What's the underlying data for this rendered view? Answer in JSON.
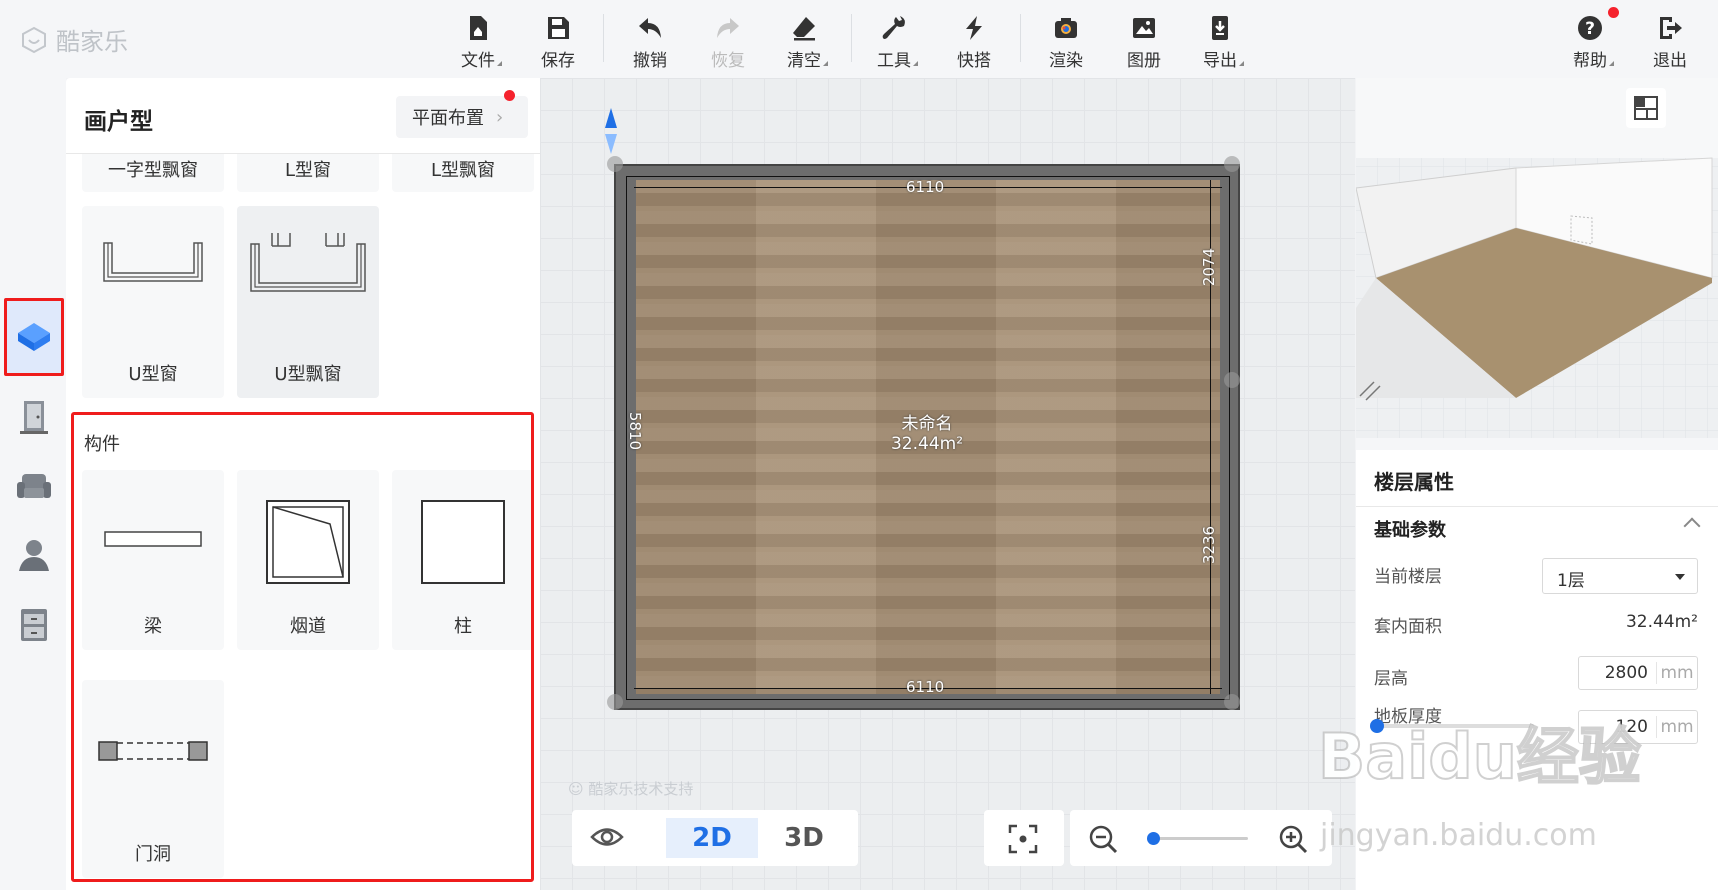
{
  "app": {
    "logo": "酷家乐"
  },
  "toolbar": [
    {
      "label": "文件",
      "icon": "file-icon"
    },
    {
      "label": "保存",
      "icon": "save-icon"
    },
    {
      "label": "撤销",
      "icon": "undo-icon"
    },
    {
      "label": "恢复",
      "icon": "redo-icon"
    },
    {
      "label": "清空",
      "icon": "eraser-icon"
    },
    {
      "label": "工具",
      "icon": "wrench-icon"
    },
    {
      "label": "快搭",
      "icon": "lightning-icon"
    },
    {
      "label": "渲染",
      "icon": "camera-icon"
    },
    {
      "label": "图册",
      "icon": "image-icon"
    },
    {
      "label": "导出",
      "icon": "export-icon"
    },
    {
      "label": "帮助",
      "icon": "help-icon"
    },
    {
      "label": "退出",
      "icon": "logout-icon"
    }
  ],
  "panel": {
    "title": "画户型",
    "layout_button": "平面布置",
    "partial_row": [
      "一字型飘窗",
      "L型窗",
      "L型飘窗"
    ],
    "windows": [
      "U型窗",
      "U型飘窗"
    ],
    "section_label": "构件",
    "components": [
      "梁",
      "烟道",
      "柱",
      "门洞"
    ]
  },
  "canvas": {
    "room_name": "未命名",
    "room_area": "32.44m²",
    "dim_top": "6110",
    "dim_bottom": "6110",
    "dim_left": "5810",
    "dim_right_upper": "2074",
    "dim_right_lower": "3236",
    "watermark": "酷家乐技术支持"
  },
  "bottom": {
    "view_2d": "2D",
    "view_3d": "3D",
    "zoom_level": 0.05
  },
  "properties": {
    "title": "楼层属性",
    "section": "基础参数",
    "current_floor_label": "当前楼层",
    "current_floor_value": "1层",
    "area_label": "套内面积",
    "area_value": "32.44m²",
    "height_label": "层高",
    "height_value": "2800",
    "height_unit": "mm",
    "thickness_label": "地板厚度",
    "thickness_value": "120",
    "thickness_unit": "mm",
    "thickness_slider": 0.0
  },
  "overlay": {
    "baidu_logo": "Baidu经验",
    "baidu_url": "jingyan.baidu.com"
  }
}
